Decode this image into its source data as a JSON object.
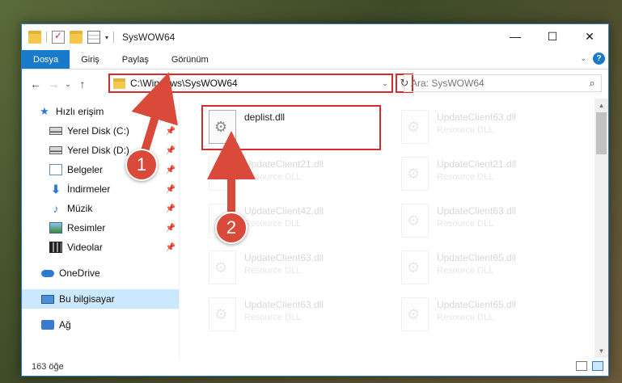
{
  "window": {
    "title": "SysWOW64"
  },
  "ribbon": {
    "tabs": [
      "Dosya",
      "Giriş",
      "Paylaş",
      "Görünüm"
    ]
  },
  "address": {
    "path": "C:\\Windows\\SysWOW64"
  },
  "search": {
    "placeholder": "Ara: SysWOW64"
  },
  "sidebar": {
    "items": [
      {
        "label": "Hızlı erişim",
        "icon": "star-icon"
      },
      {
        "label": "Yerel Disk (C:)",
        "icon": "disk-icon",
        "pinned": true
      },
      {
        "label": "Yerel Disk (D:)",
        "icon": "disk-icon",
        "pinned": true
      },
      {
        "label": "Belgeler",
        "icon": "document-icon",
        "pinned": true
      },
      {
        "label": "İndirmeler",
        "icon": "download-icon",
        "pinned": true
      },
      {
        "label": "Müzik",
        "icon": "music-icon",
        "pinned": true
      },
      {
        "label": "Resimler",
        "icon": "pictures-icon",
        "pinned": true
      },
      {
        "label": "Videolar",
        "icon": "video-icon",
        "pinned": true
      },
      {
        "label": "OneDrive",
        "icon": "cloud-icon"
      },
      {
        "label": "Bu bilgisayar",
        "icon": "computer-icon",
        "selected": true
      },
      {
        "label": "Ağ",
        "icon": "network-icon"
      }
    ]
  },
  "files": [
    {
      "name": "deplist.dll",
      "type": ""
    },
    {
      "name": "UpdateClient63.dll",
      "type": "Resource DLL"
    },
    {
      "name": "UpdateClient21.dll",
      "type": "Resource DLL"
    },
    {
      "name": "UpdateClient21.dll",
      "type": "Resource DLL"
    },
    {
      "name": "UpdateClient42.dll",
      "type": "Resource DLL"
    },
    {
      "name": "UpdateClient63.dll",
      "type": "Resource DLL"
    },
    {
      "name": "UpdateClient63.dll",
      "type": "Resource DLL"
    },
    {
      "name": "UpdateClient65.dll",
      "type": "Resource DLL"
    },
    {
      "name": "UpdateClient63.dll",
      "type": "Resource DLL"
    },
    {
      "name": "UpdateClient65.dll",
      "type": "Resource DLL"
    }
  ],
  "status": {
    "count": "163 öğe"
  },
  "annotations": {
    "step1": "1",
    "step2": "2",
    "color": "#d94a3a"
  }
}
